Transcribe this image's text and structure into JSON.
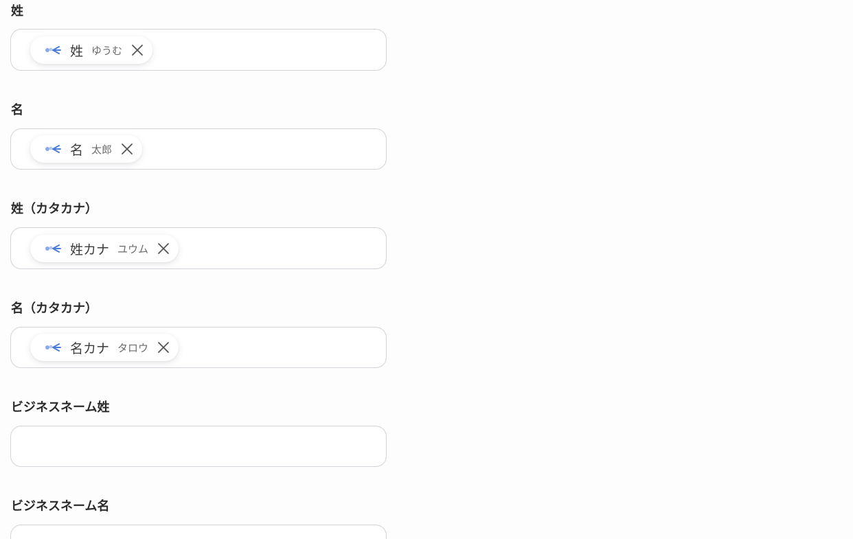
{
  "fields": [
    {
      "label": "姓",
      "chip": {
        "title": "姓",
        "value": "ゆうむ"
      }
    },
    {
      "label": "名",
      "chip": {
        "title": "名",
        "value": "太郎"
      }
    },
    {
      "label": "姓（カタカナ）",
      "chip": {
        "title": "姓カナ",
        "value": "ユウム"
      }
    },
    {
      "label": "名（カタカナ）",
      "chip": {
        "title": "名カナ",
        "value": "タロウ"
      }
    },
    {
      "label": "ビジネスネーム姓",
      "chip": null
    },
    {
      "label": "ビジネスネーム名",
      "chip": null
    }
  ],
  "icons": {
    "chip_icon": "app-logo-icon",
    "remove_icon": "close-icon"
  },
  "colors": {
    "accent_blue": "#4a7bdc",
    "border": "#d3d3da",
    "background": "#fefdfd"
  }
}
